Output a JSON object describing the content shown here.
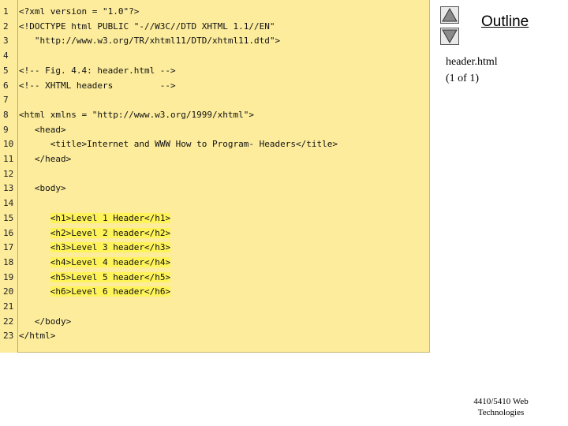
{
  "nav": {
    "up_icon": "triangle-up-icon",
    "down_icon": "triangle-down-icon"
  },
  "outline_label": "Outline",
  "side": {
    "file": "header.html",
    "page": "(1 of 1)"
  },
  "footer": {
    "line1": "4410/5410 Web",
    "line2": "Technologies"
  },
  "code_lines": [
    {
      "n": "1",
      "t": "<?xml version = \"1.0\"?>"
    },
    {
      "n": "2",
      "t": "<!DOCTYPE html PUBLIC \"-//W3C//DTD XHTML 1.1//EN\""
    },
    {
      "n": "3",
      "t": "   \"http://www.w3.org/TR/xhtml11/DTD/xhtml11.dtd\">"
    },
    {
      "n": "4",
      "t": ""
    },
    {
      "n": "5",
      "t": "<!-- Fig. 4.4: header.html -->"
    },
    {
      "n": "6",
      "t": "<!-- XHTML headers         -->"
    },
    {
      "n": "7",
      "t": ""
    },
    {
      "n": "8",
      "t": "<html xmlns = \"http://www.w3.org/1999/xhtml\">"
    },
    {
      "n": "9",
      "t": "   <head>"
    },
    {
      "n": "10",
      "t": "      <title>Internet and WWW How to Program- Headers</title>"
    },
    {
      "n": "11",
      "t": "   </head>"
    },
    {
      "n": "12",
      "t": ""
    },
    {
      "n": "13",
      "t": "   <body>"
    },
    {
      "n": "14",
      "t": ""
    },
    {
      "n": "15",
      "t": "      <h1>Level 1 Header</h1>"
    },
    {
      "n": "16",
      "t": "      <h2>Level 2 header</h2>"
    },
    {
      "n": "17",
      "t": "      <h3>Level 3 header</h3>"
    },
    {
      "n": "18",
      "t": "      <h4>Level 4 header</h4>"
    },
    {
      "n": "19",
      "t": "      <h5>Level 5 header</h5>"
    },
    {
      "n": "20",
      "t": "      <h6>Level 6 header</h6>"
    },
    {
      "n": "21",
      "t": ""
    },
    {
      "n": "22",
      "t": "   </body>"
    },
    {
      "n": "23",
      "t": "</html>"
    }
  ],
  "highlighted_lines": [
    "15",
    "16",
    "17",
    "18",
    "19",
    "20"
  ],
  "colors": {
    "panel_bg": "#fcec9c",
    "highlight": "#fff35a"
  }
}
